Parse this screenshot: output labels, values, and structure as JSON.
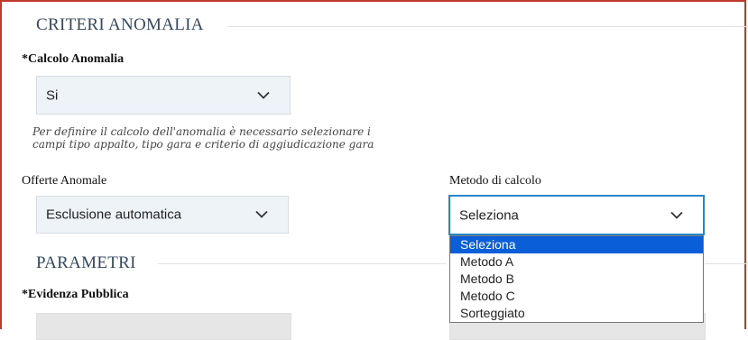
{
  "criteri": {
    "title": "CRITERI ANOMALIA",
    "calcolo_label": "*Calcolo Anomalia",
    "calcolo_value": "Si",
    "hint_line1": "Per definire il calcolo dell'anomalia è necessario selezionare i",
    "hint_line2": "campi tipo appalto, tipo gara e criterio di aggiudicazione gara",
    "offerte_label": "Offerte Anomale",
    "offerte_value": "Esclusione automatica",
    "metodo_label": "Metodo di calcolo",
    "metodo_value": "Seleziona"
  },
  "dropdown": {
    "options": [
      "Seleziona",
      "Metodo A",
      "Metodo B",
      "Metodo C",
      "Sorteggiato"
    ],
    "selected": "Seleziona"
  },
  "parametri": {
    "title": "PARAMETRI",
    "evidenza_label": "*Evidenza Pubblica"
  },
  "colors": {
    "accent_border": "#c0392b",
    "focus_border": "#2a86c9",
    "selected_option": "#0a5fd8",
    "select_bg": "#eef3f8"
  },
  "icons": {
    "chevron": "chevron-down-icon"
  }
}
